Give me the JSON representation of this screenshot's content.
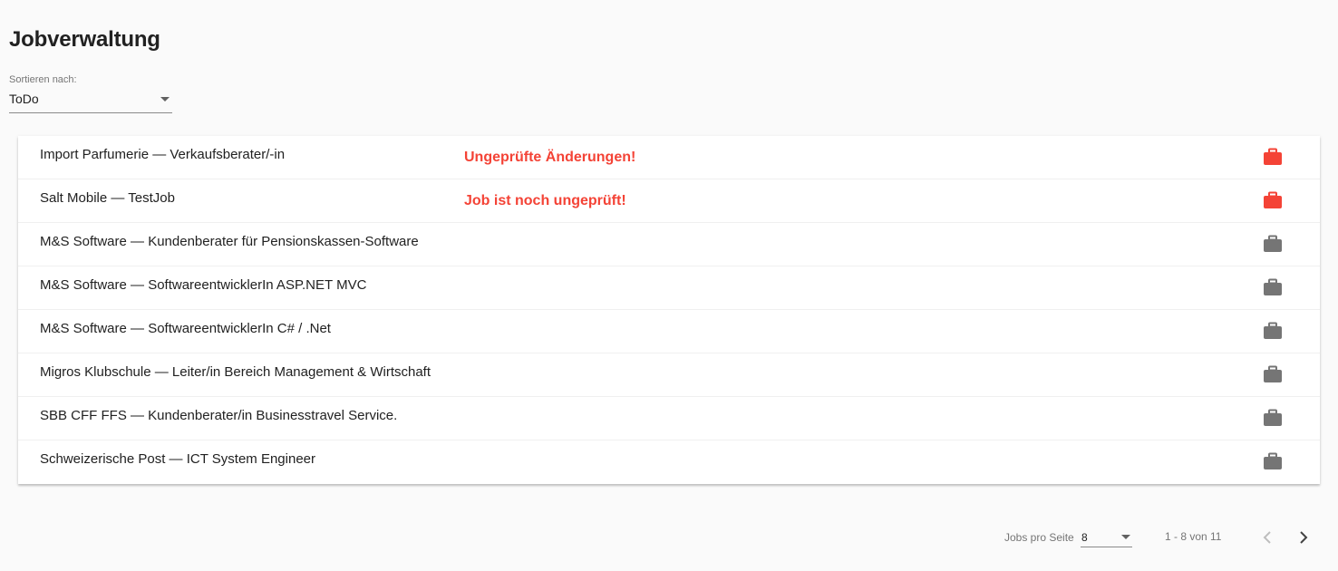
{
  "page": {
    "title": "Jobverwaltung"
  },
  "sort": {
    "label": "Sortieren nach:",
    "value": "ToDo"
  },
  "jobs": [
    {
      "title": "Import Parfumerie — Verkaufsberater/-in",
      "warning": "Ungeprüfte Änderungen!",
      "icon": "briefcase-icon",
      "icon_color": "#f44336"
    },
    {
      "title": "Salt Mobile — TestJob",
      "warning": "Job ist noch ungeprüft!",
      "icon": "briefcase-icon",
      "icon_color": "#f44336"
    },
    {
      "title": "M&S Software — Kundenberater für Pensionskassen-Software",
      "warning": "",
      "icon": "briefcase-icon",
      "icon_color": "#757575"
    },
    {
      "title": "M&S Software — SoftwareentwicklerIn ASP.NET MVC",
      "warning": "",
      "icon": "briefcase-icon",
      "icon_color": "#757575"
    },
    {
      "title": "M&S Software — SoftwareentwicklerIn C# / .Net",
      "warning": "",
      "icon": "briefcase-icon",
      "icon_color": "#757575"
    },
    {
      "title": "Migros Klubschule — Leiter/in Bereich Management & Wirtschaft",
      "warning": "",
      "icon": "briefcase-icon",
      "icon_color": "#757575"
    },
    {
      "title": "SBB CFF FFS — Kundenberater/in Businesstravel Service.",
      "warning": "",
      "icon": "briefcase-icon",
      "icon_color": "#757575"
    },
    {
      "title": "Schweizerische Post — ICT System Engineer",
      "warning": "",
      "icon": "briefcase-icon",
      "icon_color": "#757575"
    }
  ],
  "paginator": {
    "page_size_label": "Jobs pro Seite",
    "page_size": "8",
    "range_label": "1 - 8 von 11",
    "prev_icon": "chevron-left-icon",
    "next_icon": "chevron-right-icon"
  },
  "colors": {
    "warning": "#f44336",
    "icon_default": "#757575",
    "background": "#fafafa"
  }
}
